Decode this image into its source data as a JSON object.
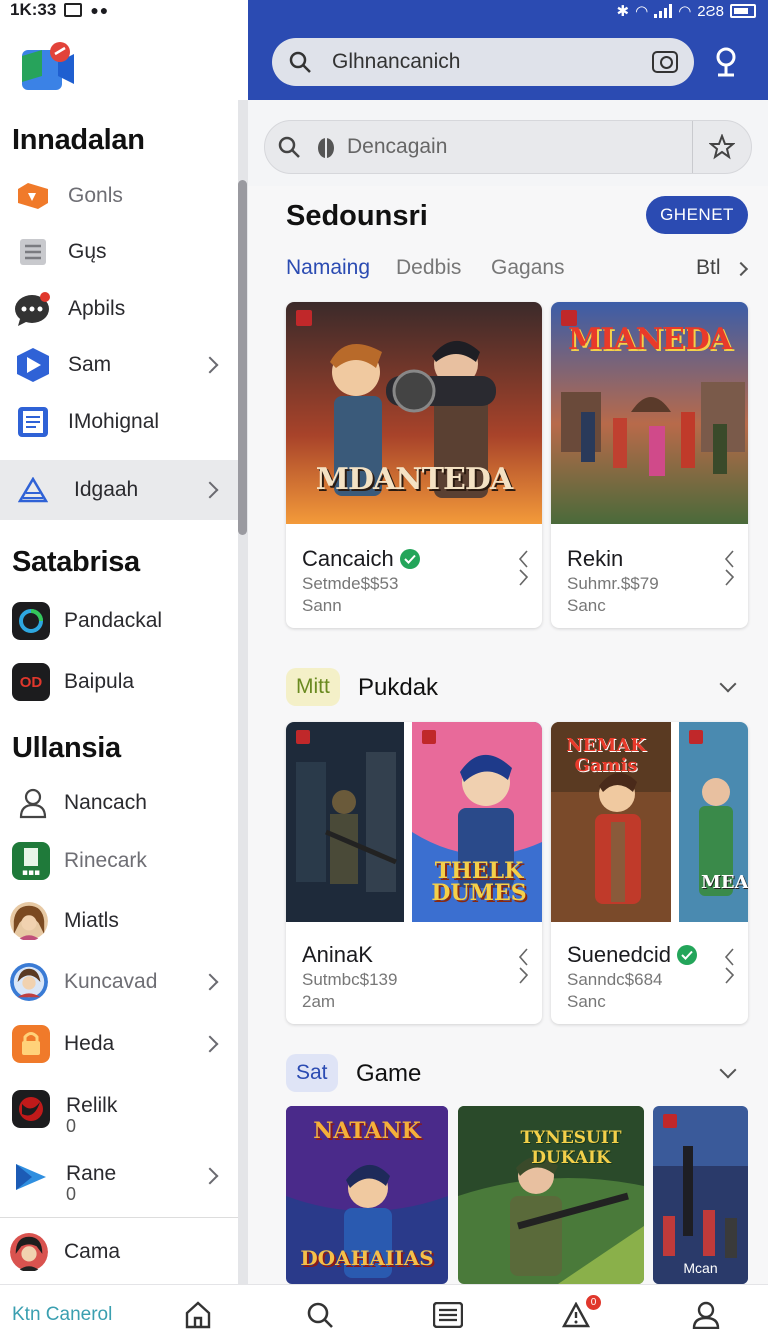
{
  "status": {
    "time": "1K:33",
    "right_text": "2Ƨ8"
  },
  "drawer": {
    "sections": [
      {
        "title": "Innadalan",
        "items": [
          {
            "label": "Gonls",
            "icon": "orange-puzzle-icon"
          },
          {
            "label": "Gųs",
            "icon": "list-doc-icon"
          },
          {
            "label": "Apbils",
            "icon": "chat-bubble-icon"
          },
          {
            "label": "Sam",
            "icon": "play-shield-icon"
          },
          {
            "label": "IMohignal",
            "icon": "document-icon"
          },
          {
            "label": "Idgaah",
            "icon": "tent-icon"
          }
        ]
      },
      {
        "title": "Satabrisa",
        "items": [
          {
            "label": "Pandackal",
            "icon": "ring-app-icon"
          },
          {
            "label": "Baipula",
            "icon": "od-app-icon",
            "icon_text": "OD"
          }
        ]
      },
      {
        "title": "Ullansia",
        "items": [
          {
            "label": "Nancach",
            "icon": "person-outline-icon"
          },
          {
            "label": "Rinecark",
            "icon": "green-app-icon"
          },
          {
            "label": "Miatls",
            "icon": "avatar-icon"
          },
          {
            "label": "Kuncavad",
            "icon": "avatar-icon"
          },
          {
            "label": "Heda",
            "icon": "orange-lock-app-icon"
          },
          {
            "label": "Relilk",
            "sub": "0",
            "icon": "red-dragon-app-icon"
          },
          {
            "label": "Rane",
            "sub": "0",
            "icon": "blue-triangle-app-icon"
          },
          {
            "label": "Cama",
            "icon": "avatar-icon"
          }
        ]
      }
    ]
  },
  "header": {
    "search_value": "Glhnancanich",
    "sub_search_value": "Dencagain"
  },
  "store": {
    "section_title": "Sedounsri",
    "action_button": "GHENET",
    "tabs": [
      "Namaing",
      "Dedbis",
      "Gagans",
      "Btl"
    ],
    "featured": [
      {
        "title": "Cancaich",
        "line1": "Setmde$$53",
        "line2": "Sann",
        "art_text": "MDANTEDA",
        "verified": true
      },
      {
        "title": "Rekin",
        "line1": "Suhmr.$$79",
        "line2": "Sanc",
        "art_text": "MIANEDA",
        "verified": false
      }
    ],
    "row1": {
      "chip": "Mitt",
      "title": "Pukdak",
      "cards": [
        {
          "title": "AninaK",
          "line1": "Sutmbc$139",
          "line2": "2am",
          "verified": false
        },
        {
          "title": "Suenedcid",
          "line1": "Sanndc$684",
          "line2": "Sanc",
          "verified": true
        }
      ],
      "art_texts": [
        "THELK DUMES",
        "NEMAK Gamis",
        "MEA"
      ]
    },
    "row2": {
      "chip": "Sat",
      "title": "Game",
      "art_texts": [
        "NATANK",
        "DOAHAIIAS",
        "TYNESUIT DUKAIK",
        "Mcan"
      ]
    }
  },
  "bottom_nav": {
    "label": "Ktn Canerol",
    "badge": "0",
    "icons": [
      "home-icon",
      "search-icon",
      "library-icon",
      "alert-icon",
      "profile-icon"
    ]
  },
  "colors": {
    "primary": "#2b4bb2",
    "chip_yellow": "#f4f0c8",
    "chip_blue": "#dfe4f6",
    "verified": "#23a55a"
  }
}
